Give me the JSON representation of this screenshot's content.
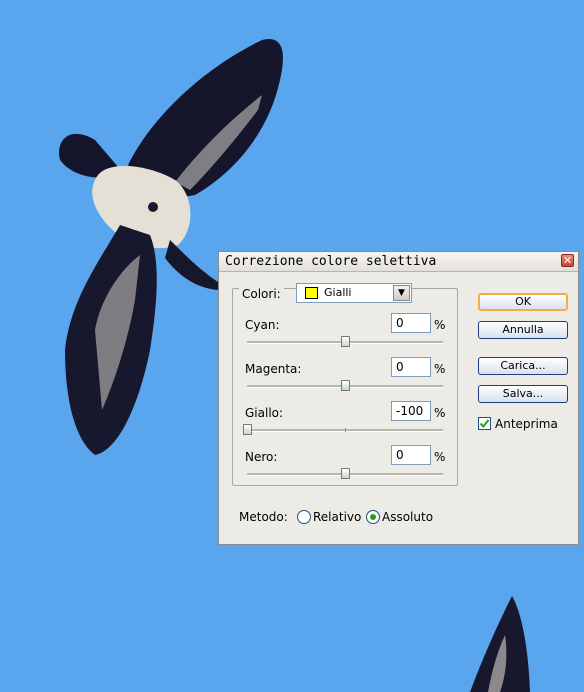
{
  "dialog": {
    "title": "Correzione colore selettiva",
    "colors": {
      "label": "Colori:",
      "selected": "Gialli",
      "swatch_color": "#ffff00"
    },
    "sliders": [
      {
        "label": "Cyan:",
        "value": "0",
        "unit": "%",
        "level": 0
      },
      {
        "label": "Magenta:",
        "value": "0",
        "unit": "%",
        "level": 0
      },
      {
        "label": "Giallo:",
        "value": "-100",
        "unit": "%",
        "level": -100
      },
      {
        "label": "Nero:",
        "value": "0",
        "unit": "%",
        "level": 0
      }
    ],
    "buttons": {
      "ok": "OK",
      "cancel": "Annulla",
      "load": "Carica...",
      "save": "Salva..."
    },
    "preview": {
      "label": "Anteprima",
      "checked": true
    },
    "method": {
      "label": "Metodo:",
      "relative": "Relativo",
      "absolute": "Assoluto",
      "selected": "Assoluto"
    }
  },
  "icons": {
    "close": "close-icon",
    "dropdown": "chevron-down-icon",
    "check": "checkmark-icon"
  },
  "colors": {
    "sky": "#5aa6ee",
    "dialog_bg": "#ecebe5",
    "radio_accent": "#21a121",
    "check_accent": "#21a121"
  }
}
